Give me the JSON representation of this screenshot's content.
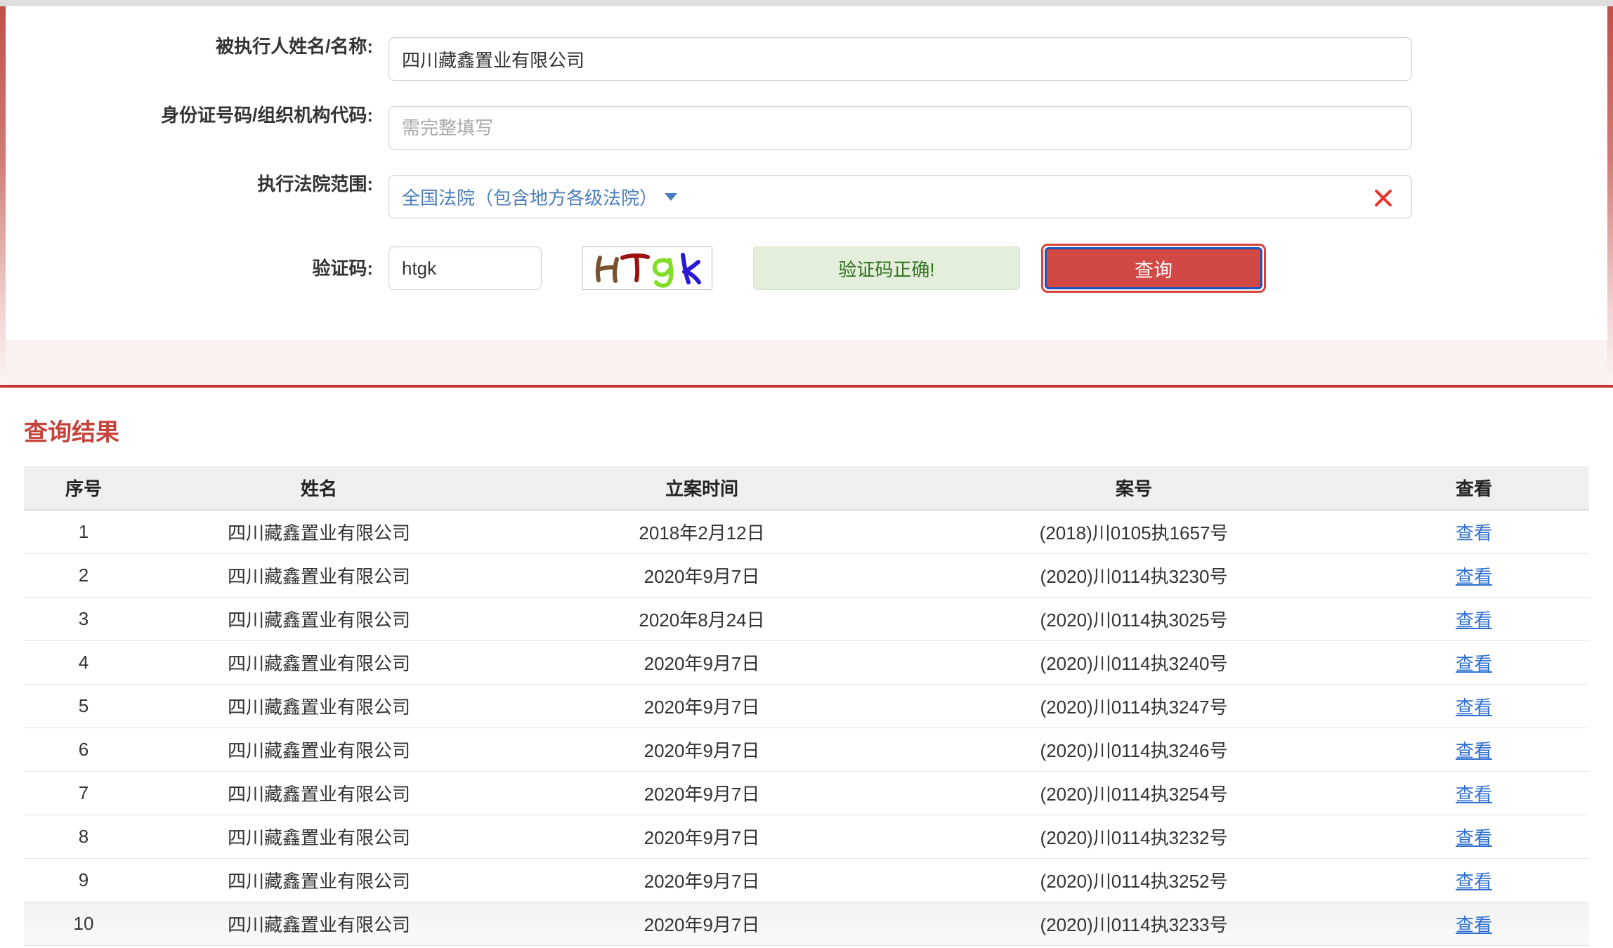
{
  "form": {
    "fields": [
      {
        "label": "被执行人姓名/名称:",
        "name": "executed-person-name",
        "value": "四川藏鑫置业有限公司",
        "placeholder": ""
      },
      {
        "label": "身份证号码/组织机构代码:",
        "name": "id-or-org-code",
        "value": "",
        "placeholder": "需完整填写"
      }
    ],
    "court_range": {
      "label": "执行法院范围:",
      "value": "全国法院（包含地方各级法院）",
      "clear_icon": "close-x-icon",
      "caret_icon": "chevron-down-icon"
    },
    "captcha": {
      "label": "验证码:",
      "value": "htgk",
      "placeholder": "",
      "image_text": "HTgk",
      "image_chars": [
        {
          "ch": "H",
          "color": "#7a5230"
        },
        {
          "ch": "T",
          "color": "#9e1010"
        },
        {
          "ch": "g",
          "color": "#82dd28"
        },
        {
          "ch": "k",
          "color": "#2a1ad4"
        }
      ],
      "status_text": "验证码正确!",
      "status_color": "#31701f"
    },
    "submit": {
      "label": "查询",
      "bg_color": "#d14844",
      "border_color": "#1a55c0",
      "focus_ring_color": "#d9433d"
    }
  },
  "results": {
    "title": "查询结果",
    "title_color": "#c5433c",
    "columns": [
      "序号",
      "姓名",
      "立案时间",
      "案号",
      "查看"
    ],
    "view_label": "查看",
    "rows": [
      {
        "idx": "1",
        "name": "四川藏鑫置业有限公司",
        "date": "2018年2月12日",
        "case_no": "(2018)川0105执1657号",
        "view": "查看"
      },
      {
        "idx": "2",
        "name": "四川藏鑫置业有限公司",
        "date": "2020年9月7日",
        "case_no": "(2020)川0114执3230号",
        "view": "查看"
      },
      {
        "idx": "3",
        "name": "四川藏鑫置业有限公司",
        "date": "2020年8月24日",
        "case_no": "(2020)川0114执3025号",
        "view": "查看"
      },
      {
        "idx": "4",
        "name": "四川藏鑫置业有限公司",
        "date": "2020年9月7日",
        "case_no": "(2020)川0114执3240号",
        "view": "查看"
      },
      {
        "idx": "5",
        "name": "四川藏鑫置业有限公司",
        "date": "2020年9月7日",
        "case_no": "(2020)川0114执3247号",
        "view": "查看"
      },
      {
        "idx": "6",
        "name": "四川藏鑫置业有限公司",
        "date": "2020年9月7日",
        "case_no": "(2020)川0114执3246号",
        "view": "查看"
      },
      {
        "idx": "7",
        "name": "四川藏鑫置业有限公司",
        "date": "2020年9月7日",
        "case_no": "(2020)川0114执3254号",
        "view": "查看"
      },
      {
        "idx": "8",
        "name": "四川藏鑫置业有限公司",
        "date": "2020年9月7日",
        "case_no": "(2020)川0114执3232号",
        "view": "查看"
      },
      {
        "idx": "9",
        "name": "四川藏鑫置业有限公司",
        "date": "2020年9月7日",
        "case_no": "(2020)川0114执3252号",
        "view": "查看"
      },
      {
        "idx": "10",
        "name": "四川藏鑫置业有限公司",
        "date": "2020年9月7日",
        "case_no": "(2020)川0114执3233号",
        "view": "查看"
      }
    ],
    "hovered_row_index": 9
  }
}
